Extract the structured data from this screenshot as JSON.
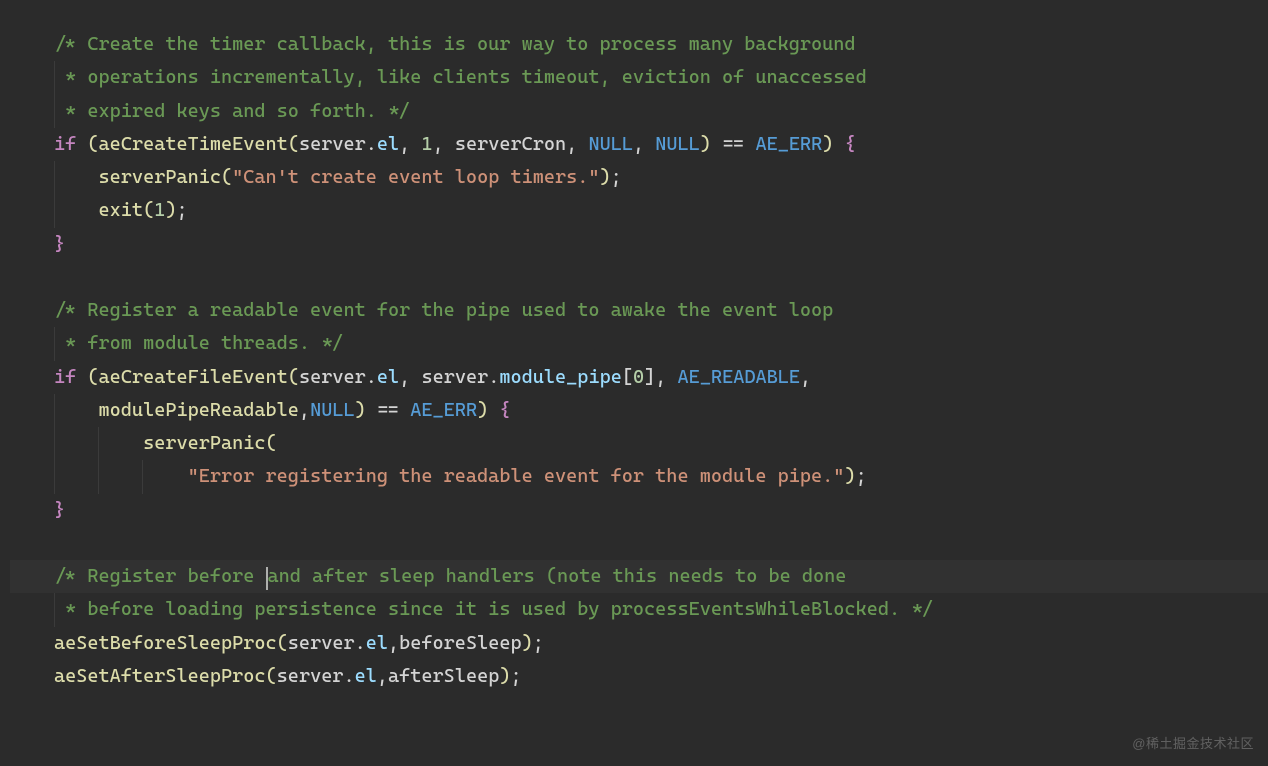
{
  "comments": {
    "c1a": "/* Create the timer callback, this is our way to process many background",
    "c1b": " * operations incrementally, like clients timeout, eviction of unaccessed",
    "c1c": " * expired keys and so forth. */",
    "c2a": "/* Register a readable event for the pipe used to awake the event loop",
    "c2b": " * from module threads. */",
    "c3a_pre": "/* Register before ",
    "c3a_post": "and after sleep handlers (note this needs to be done",
    "c3b": " * before loading persistence since it is used by processEventsWhileBlocked. */"
  },
  "kw": {
    "if": "if"
  },
  "fn": {
    "aeCreateTimeEvent": "aeCreateTimeEvent",
    "serverPanic": "serverPanic",
    "exit": "exit",
    "aeCreateFileEvent": "aeCreateFileEvent",
    "modulePipeReadable": "modulePipeReadable",
    "aeSetBeforeSleepProc": "aeSetBeforeSleepProc",
    "aeSetAfterSleepProc": "aeSetAfterSleepProc"
  },
  "id": {
    "server": "server",
    "serverCron": "serverCron",
    "beforeSleep": "beforeSleep",
    "afterSleep": "afterSleep"
  },
  "prop": {
    "el": "el",
    "module_pipe": "module_pipe"
  },
  "num": {
    "one": "1",
    "zero": "0"
  },
  "const": {
    "NULL": "NULL",
    "AE_ERR": "AE_ERR",
    "AE_READABLE": "AE_READABLE"
  },
  "str": {
    "s1": "\"Can't create event loop timers.\"",
    "s2": "\"Error registering the readable event for the module pipe.\""
  },
  "punct": {
    "lp": "(",
    "rp": ")",
    "lb": "{",
    "rb": "}",
    "lbkt": "[",
    "rbkt": "]",
    "comma": ",",
    "semi": ";",
    "dot": ".",
    "sp": " ",
    "eqeq": "=="
  },
  "watermark": "@稀土掘金技术社区"
}
